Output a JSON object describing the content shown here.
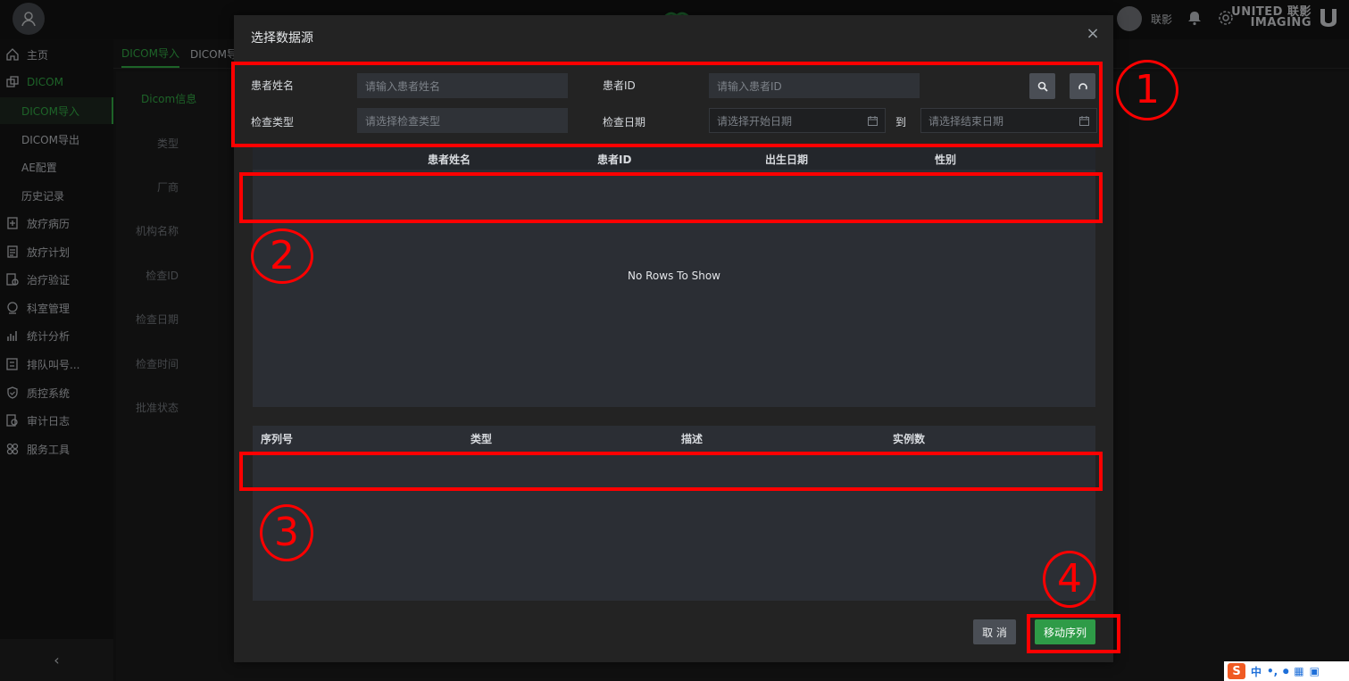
{
  "header": {
    "user_name": "联影",
    "brand_line1": "UNITED 联影",
    "brand_line2": "IMAGING"
  },
  "sidebar": {
    "items": [
      {
        "label": "主页",
        "icon": "home-icon"
      },
      {
        "label": "DICOM",
        "icon": "dicom-icon"
      },
      {
        "label": "DICOM导入"
      },
      {
        "label": "DICOM导出"
      },
      {
        "label": "AE配置"
      },
      {
        "label": "历史记录"
      },
      {
        "label": "放疗病历",
        "icon": "medical-record-icon"
      },
      {
        "label": "放疗计划",
        "icon": "plan-icon"
      },
      {
        "label": "治疗验证",
        "icon": "verify-icon"
      },
      {
        "label": "科室管理",
        "icon": "department-icon"
      },
      {
        "label": "统计分析",
        "icon": "chart-icon"
      },
      {
        "label": "排队叫号...",
        "icon": "queue-icon"
      },
      {
        "label": "质控系统",
        "icon": "shield-icon"
      },
      {
        "label": "审计日志",
        "icon": "audit-icon"
      },
      {
        "label": "服务工具",
        "icon": "tools-icon"
      }
    ]
  },
  "tabs": [
    "DICOM导入",
    "DICOM导"
  ],
  "background_form": {
    "section_title": "Dicom信息",
    "labels": [
      "类型",
      "厂商",
      "机构名称",
      "检查ID",
      "检查日期",
      "检查时间",
      "批准状态"
    ]
  },
  "modal": {
    "title": "选择数据源",
    "filters": {
      "patient_name_label": "患者姓名",
      "patient_name_placeholder": "请输入患者姓名",
      "patient_id_label": "患者ID",
      "patient_id_placeholder": "请输入患者ID",
      "exam_type_label": "检查类型",
      "exam_type_placeholder": "请选择检查类型",
      "exam_date_label": "检查日期",
      "start_date_placeholder": "请选择开始日期",
      "to_label": "到",
      "end_date_placeholder": "请选择结束日期"
    },
    "patient_table": {
      "columns": [
        "患者姓名",
        "患者ID",
        "出生日期",
        "性别"
      ],
      "empty_text": "No Rows To Show"
    },
    "series_table": {
      "columns": [
        "序列号",
        "类型",
        "描述",
        "实例数"
      ]
    },
    "buttons": {
      "cancel": "取 消",
      "move": "移动序列"
    }
  },
  "annotations": [
    "1",
    "2",
    "3",
    "4"
  ],
  "colors": {
    "accent": "#36b54a",
    "annotation": "#ff0000",
    "primary_button": "#2e9b47"
  }
}
